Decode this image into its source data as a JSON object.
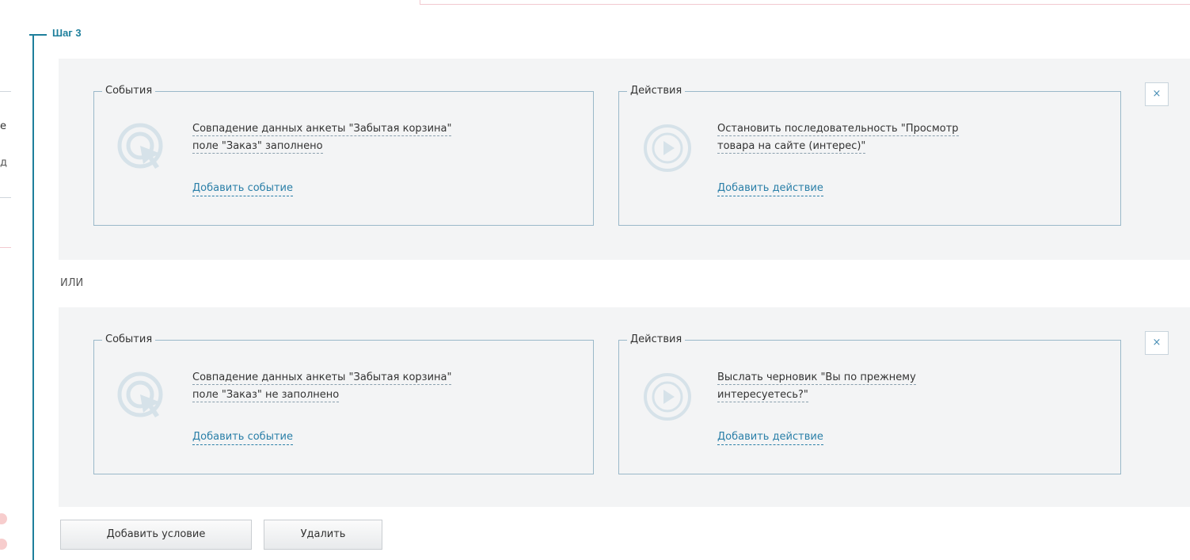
{
  "step": {
    "title": "Шаг 3"
  },
  "background_fragments": {
    "frag1": "е",
    "frag2": "д"
  },
  "conditions": [
    {
      "events": {
        "legend": "События",
        "items": [
          "Совпадение данных анкеты \"Забытая корзина\" поле \"Заказ\" заполнено"
        ],
        "line1": "Совпадение данных анкеты \"Забытая корзина\"",
        "line2": "поле \"Заказ\" заполнено",
        "add_label": "Добавить событие",
        "icon": "target-icon"
      },
      "actions": {
        "legend": "Действия",
        "line1": "Остановить последовательность \"Просмотр",
        "line2": "товара на сайте (интерес)\"",
        "add_label": "Добавить действие",
        "icon": "play-icon"
      },
      "close_label": "×"
    },
    {
      "events": {
        "legend": "События",
        "line1": "Совпадение данных анкеты \"Забытая корзина\"",
        "line2": "поле \"Заказ\" не заполнено",
        "add_label": "Добавить событие",
        "icon": "target-icon"
      },
      "actions": {
        "legend": "Действия",
        "line1": "Выслать черновик \"Вы по прежнему",
        "line2": "интересуетесь?\"",
        "add_label": "Добавить действие",
        "icon": "play-icon"
      },
      "close_label": "×"
    }
  ],
  "or_label": "ИЛИ",
  "buttons": {
    "add_condition": "Добавить условие",
    "delete": "Удалить"
  },
  "colors": {
    "accent": "#1e7f9c",
    "link": "#2a7fa8",
    "panel_bg": "#f3f4f5",
    "fieldset_border": "#9ab8c9"
  }
}
